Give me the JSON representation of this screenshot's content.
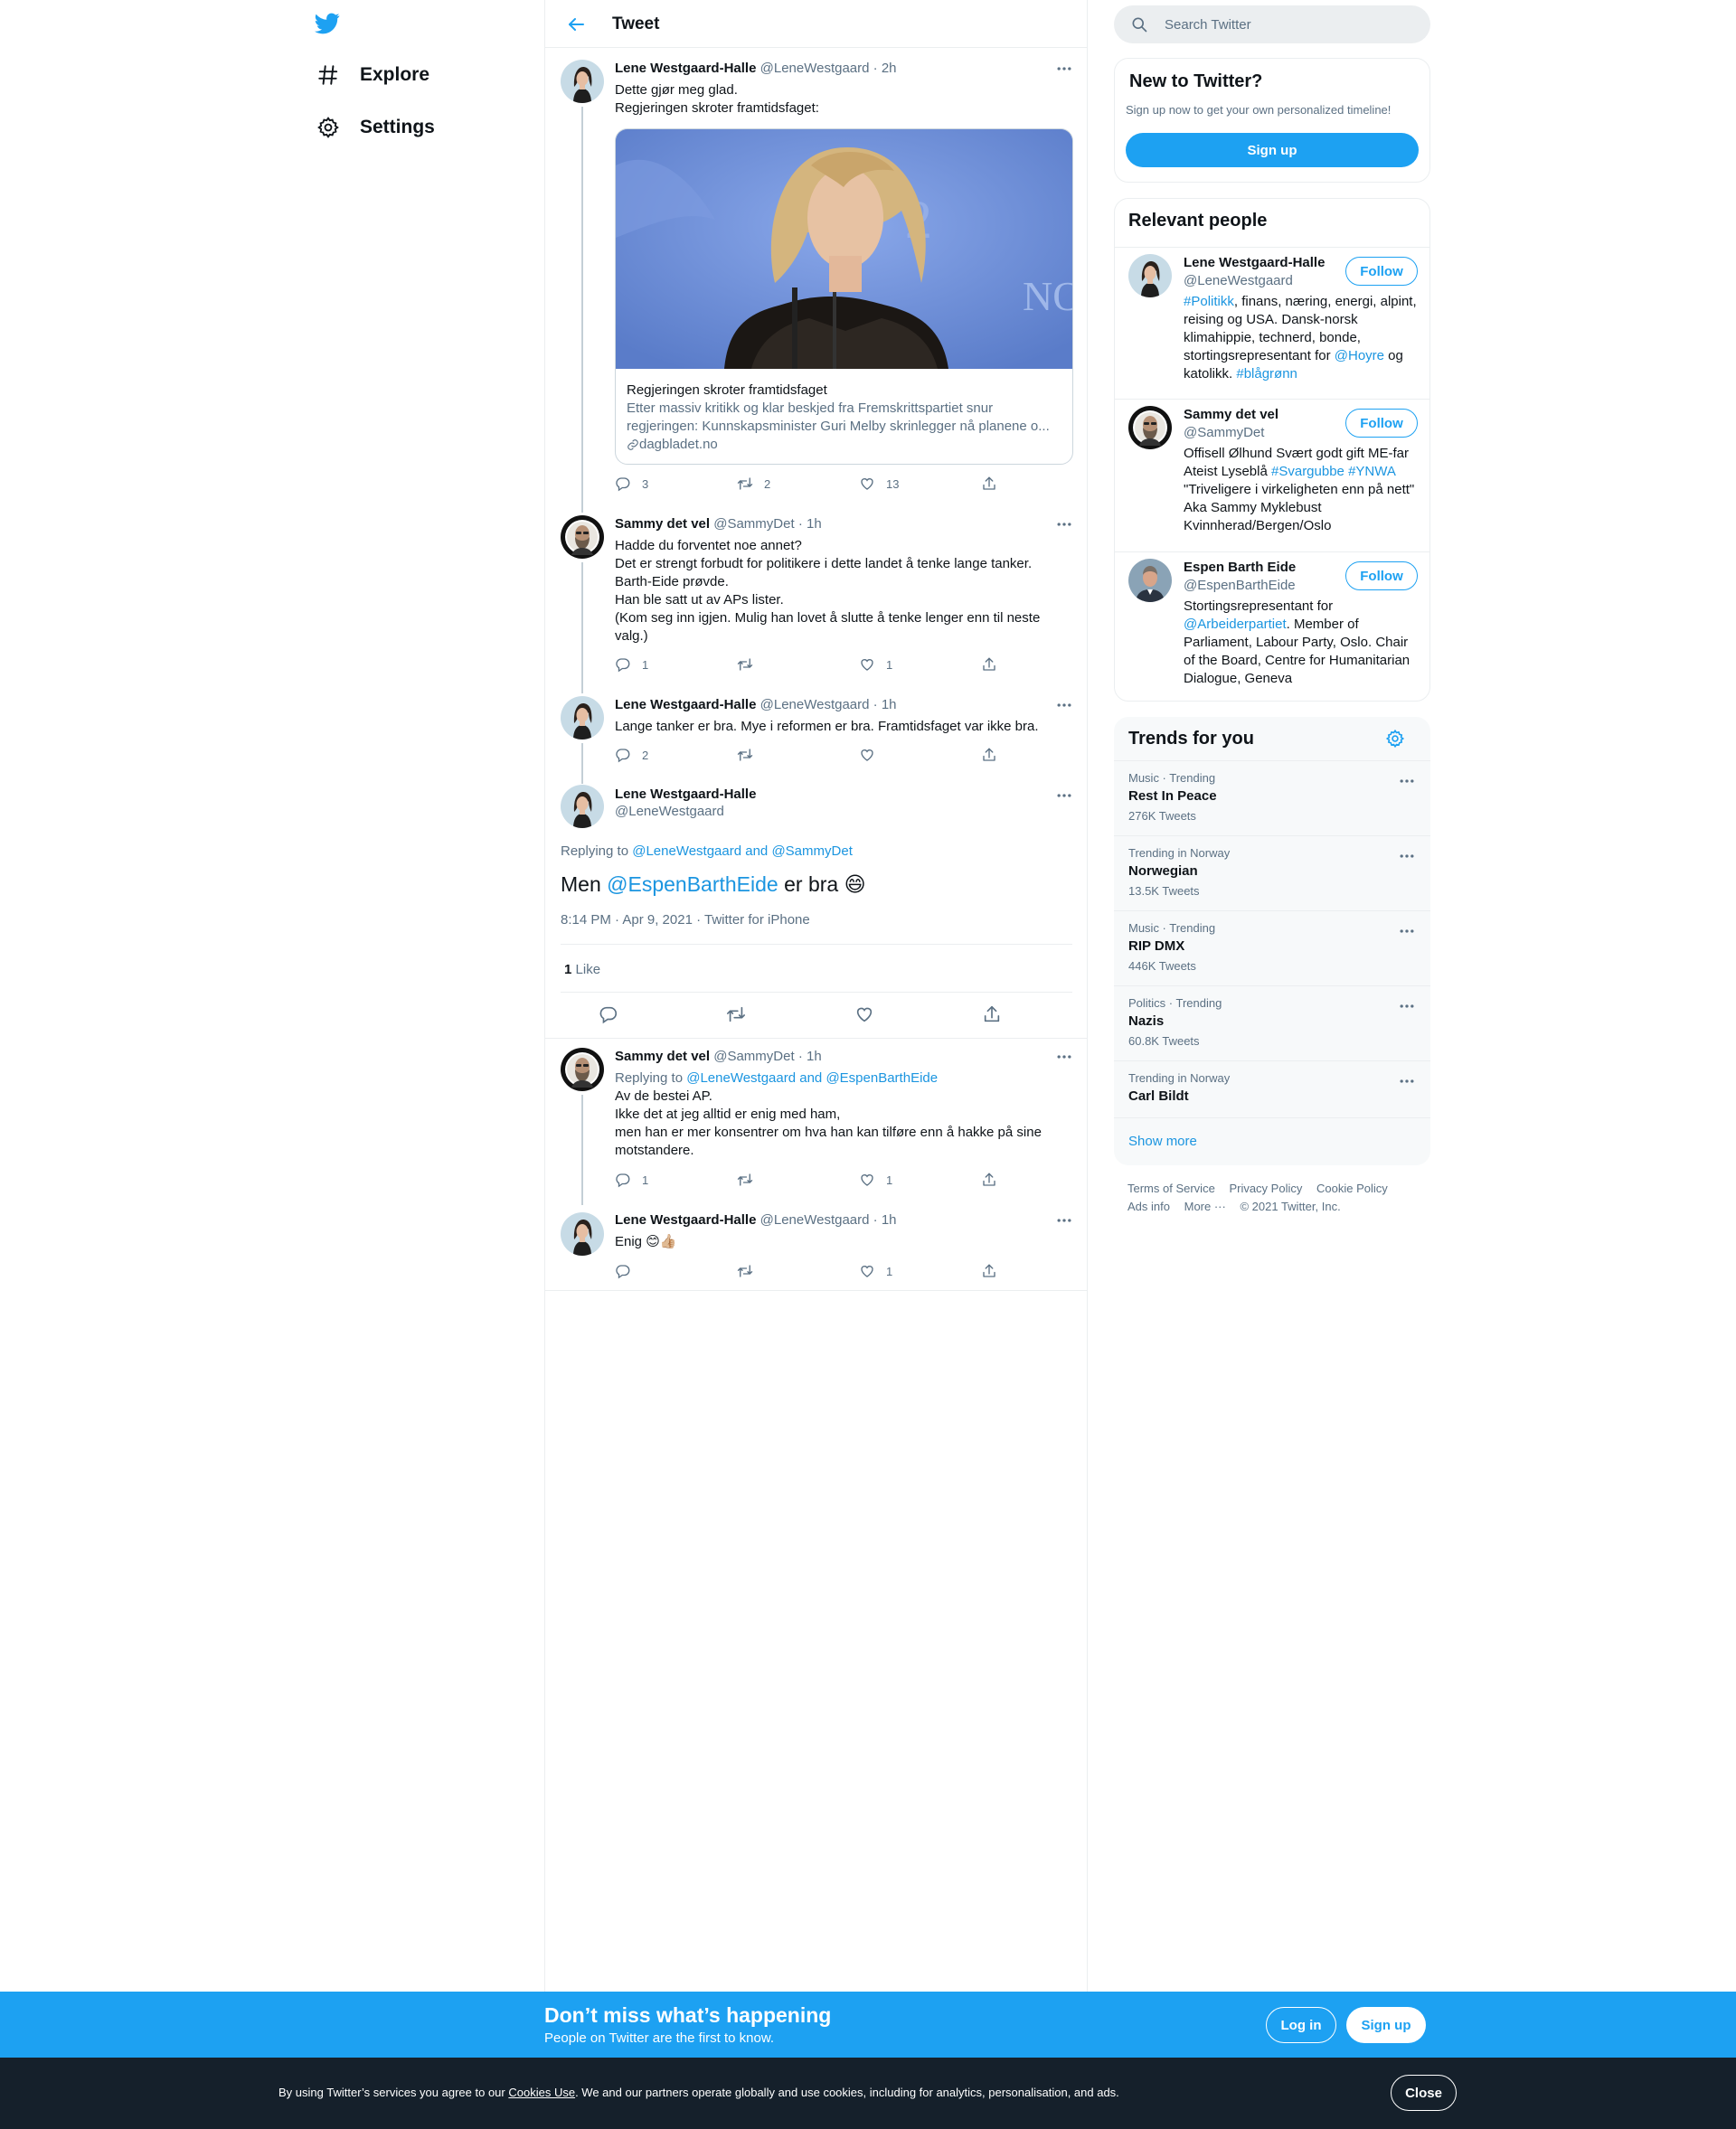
{
  "colors": {
    "brand": "#1da1f2",
    "link": "#1b95e0",
    "muted": "#5b7083",
    "cookie_bg": "#15202b"
  },
  "nav": {
    "logo_icon": "twitter-bird-icon",
    "items": [
      {
        "label": "Explore",
        "icon": "hashtag-icon"
      },
      {
        "label": "Settings",
        "icon": "gear-icon"
      }
    ]
  },
  "header": {
    "title": "Tweet",
    "back_icon": "arrow-left-icon"
  },
  "tweets": [
    {
      "name": "Lene Westgaard-Halle",
      "handle": "@LeneWestgaard",
      "time": "· 2h",
      "lines": [
        "Dette gjør meg glad.",
        "Regjeringen skroter framtidsfaget:"
      ],
      "card": {
        "title": "Regjeringen skroter framtidsfaget",
        "desc_1": "Etter massiv kritikk og klar beskjed fra Fremskrittspartiet snur",
        "desc_2": "regjeringen: Kunnskapsminister Guri Melby skrinlegger nå planene o...",
        "domain": "dagbladet.no"
      },
      "replies": "3",
      "retweets": "2",
      "likes": "13"
    },
    {
      "name": "Sammy det vel",
      "handle": "@SammyDet",
      "time": "· 1h",
      "lines": [
        "Hadde du forventet noe annet?",
        "Det er strengt forbudt for politikere i dette landet å tenke lange tanker.",
        "Barth-Eide prøvde.",
        "Han ble satt ut av APs lister.",
        "(Kom seg inn igjen. Mulig han lovet å slutte å tenke lenger enn til neste",
        "valg.)"
      ],
      "replies": "1",
      "retweets": "",
      "likes": "1"
    },
    {
      "name": "Lene Westgaard-Halle",
      "handle": "@LeneWestgaard",
      "time": "· 1h",
      "lines": [
        "Lange tanker er bra. Mye i reformen er bra. Framtidsfaget var ikke bra."
      ],
      "replies": "2",
      "retweets": "",
      "likes": ""
    }
  ],
  "focus": {
    "name": "Lene Westgaard-Halle",
    "handle": "@LeneWestgaard",
    "replying_prefix": "Replying to",
    "replying_to_1": "@LeneWestgaard",
    "replying_and": "and",
    "replying_to_2": "@SammyDet",
    "text_pre": "Men",
    "mention": "@EspenBarthEide",
    "text_post": "er bra",
    "emoji": "😄",
    "timestamp": "8:14 PM · Apr 9, 2021",
    "source": "Twitter for iPhone",
    "like_count": "1",
    "like_label": "Like"
  },
  "replies": [
    {
      "name": "Sammy det vel",
      "handle": "@SammyDet",
      "time": "· 1h",
      "replying_prefix": "Replying to",
      "replying_to_1": "@LeneWestgaard",
      "replying_and": "and",
      "replying_to_2": "@EspenBarthEide",
      "lines": [
        "Av de bestei AP.",
        "Ikke det at jeg alltid er enig med ham,",
        "men han er mer konsentrer om hva han kan tilføre enn å hakke på sine",
        "motstandere."
      ],
      "replies": "1",
      "retweets": "",
      "likes": "1"
    },
    {
      "name": "Lene Westgaard-Halle",
      "handle": "@LeneWestgaard",
      "time": "· 1h",
      "text": "Enig",
      "emoji": "😊👍🏼",
      "replies": "",
      "retweets": "",
      "likes": "1"
    }
  ],
  "search": {
    "placeholder": "Search Twitter"
  },
  "new_to_twitter": {
    "title": "New to Twitter?",
    "subtitle": "Sign up now to get your own personalized timeline!",
    "button": "Sign up"
  },
  "relevant_people": {
    "title": "Relevant people",
    "follow_label": "Follow",
    "people": [
      {
        "name": "Lene Westgaard-Halle",
        "handle": "@LeneWestgaard",
        "bio_parts": [
          {
            "t": "#Politikk",
            "link": true
          },
          {
            "t": ", finans, næring, energi, alpint, reising og USA. Dansk-norsk klimahippie, technerd, bonde, stortingsrepresentant for ",
            "link": false
          },
          {
            "t": "@Hoyre",
            "link": true
          },
          {
            "t": " og katolikk. ",
            "link": false
          },
          {
            "t": "#blågrønn",
            "link": true
          }
        ]
      },
      {
        "name": "Sammy det vel",
        "handle": "@SammyDet",
        "bio_parts": [
          {
            "t": "Offisell Ølhund Svært godt gift ME-far Ateist Lyseblå ",
            "link": false
          },
          {
            "t": "#Svargubbe",
            "link": true
          },
          {
            "t": " ",
            "link": false
          },
          {
            "t": "#YNWA",
            "link": true
          },
          {
            "t": " \"Triveligere i virkeligheten enn på nett\" Aka Sammy Myklebust Kvinnherad/Bergen/Oslo",
            "link": false
          }
        ]
      },
      {
        "name": "Espen Barth Eide",
        "handle": "@EspenBarthEide",
        "bio_parts": [
          {
            "t": "Stortingsrepresentant for ",
            "link": false
          },
          {
            "t": "@Arbeiderpartiet",
            "link": true
          },
          {
            "t": ". Member of Parliament, Labour Party, Oslo. Chair of the Board, Centre for Humanitarian Dialogue, Geneva",
            "link": false
          }
        ]
      }
    ]
  },
  "trends": {
    "title": "Trends for you",
    "items": [
      {
        "context": "Music · Trending",
        "name": "Rest In Peace",
        "count": "276K Tweets"
      },
      {
        "context": "Trending in Norway",
        "name": "Norwegian",
        "count": "13.5K Tweets"
      },
      {
        "context": "Music · Trending",
        "name": "RIP DMX",
        "count": "446K Tweets"
      },
      {
        "context": "Politics · Trending",
        "name": "Nazis",
        "count": "60.8K Tweets"
      },
      {
        "context": "Trending in Norway",
        "name": "Carl Bildt",
        "count": ""
      }
    ],
    "show_more": "Show more"
  },
  "footer": {
    "terms": "Terms of Service",
    "privacy": "Privacy Policy",
    "cookie": "Cookie Policy",
    "ads": "Ads info",
    "more": "More ···",
    "copyright": "© 2021 Twitter, Inc."
  },
  "bottom_bar": {
    "title": "Don’t miss what’s happening",
    "subtitle": "People on Twitter are the first to know.",
    "login": "Log in",
    "signup": "Sign up"
  },
  "cookie_bar": {
    "text_1": "By using Twitter’s services you agree to our",
    "link": "Cookies Use",
    "text_2": ". We and our partners operate globally and use cookies, including for analytics, personalisation, and ads.",
    "close": "Close"
  }
}
